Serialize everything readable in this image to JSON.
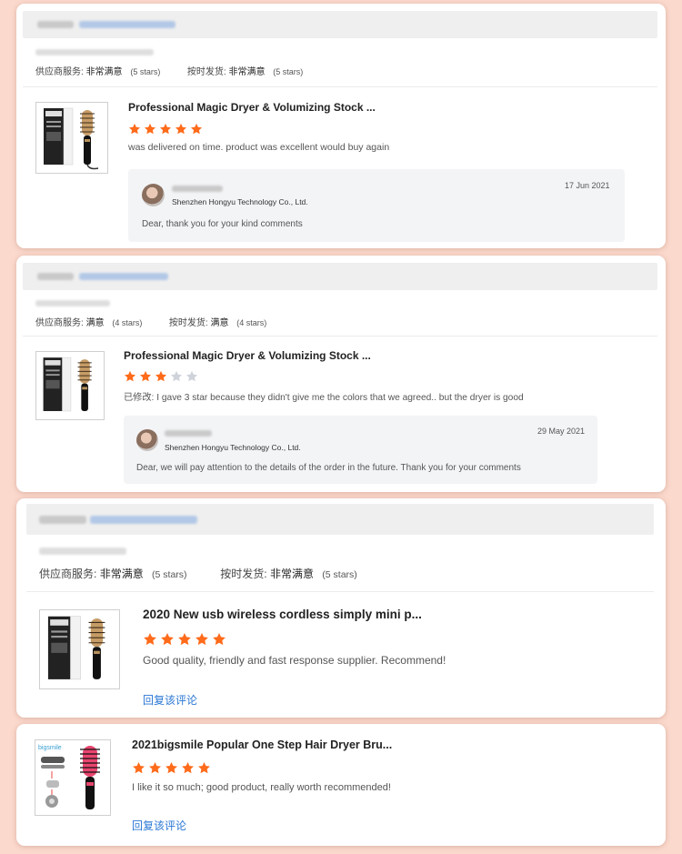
{
  "colors": {
    "background": "#fbd9cd",
    "star_on": "#ff6b1a",
    "star_off": "#cfd3da",
    "link": "#2a77d4"
  },
  "reviews": [
    {
      "supplier_service_label": "供应商服务:",
      "supplier_service_value": "非常满意",
      "supplier_service_stars": "(5 stars)",
      "shipping_label": "按时发货:",
      "shipping_value": "非常满意",
      "shipping_stars": "(5 stars)",
      "product_title": "Professional Magic Dryer & Volumizing Stock ...",
      "rating": 5,
      "comment": "was delivered on time. product was excellent would buy again",
      "reply": {
        "company": "Shenzhen Hongyu Technology Co., Ltd.",
        "date": "17 Jun 2021",
        "text": "Dear, thank you for your kind comments"
      }
    },
    {
      "supplier_service_label": "供应商服务:",
      "supplier_service_value": "满意",
      "supplier_service_stars": "(4 stars)",
      "shipping_label": "按时发货:",
      "shipping_value": "满意",
      "shipping_stars": "(4 stars)",
      "product_title": "Professional Magic Dryer & Volumizing Stock ...",
      "rating": 3,
      "comment": "已修改: I gave 3 star because they didn't give me the colors that we agreed.. but the dryer is good",
      "reply": {
        "company": "Shenzhen Hongyu Technology Co., Ltd.",
        "date": "29 May 2021",
        "text": "Dear, we will pay attention to the details of the order in the future. Thank you for your comments"
      }
    },
    {
      "supplier_service_label": "供应商服务:",
      "supplier_service_value": "非常满意",
      "supplier_service_stars": "(5 stars)",
      "shipping_label": "按时发货:",
      "shipping_value": "非常满意",
      "shipping_stars": "(5 stars)",
      "product_title": "2020 New usb wireless cordless simply mini p...",
      "rating": 5,
      "comment": "Good quality, friendly and fast response supplier. Recommend!",
      "reply_link": "回复该评论"
    },
    {
      "product_title": "2021bigsmile Popular One Step Hair Dryer Bru...",
      "rating": 5,
      "comment": "I like it so much; good product, really worth recommended!",
      "reply_link": "回复该评论",
      "thumb_brand": "bigsmile"
    }
  ]
}
